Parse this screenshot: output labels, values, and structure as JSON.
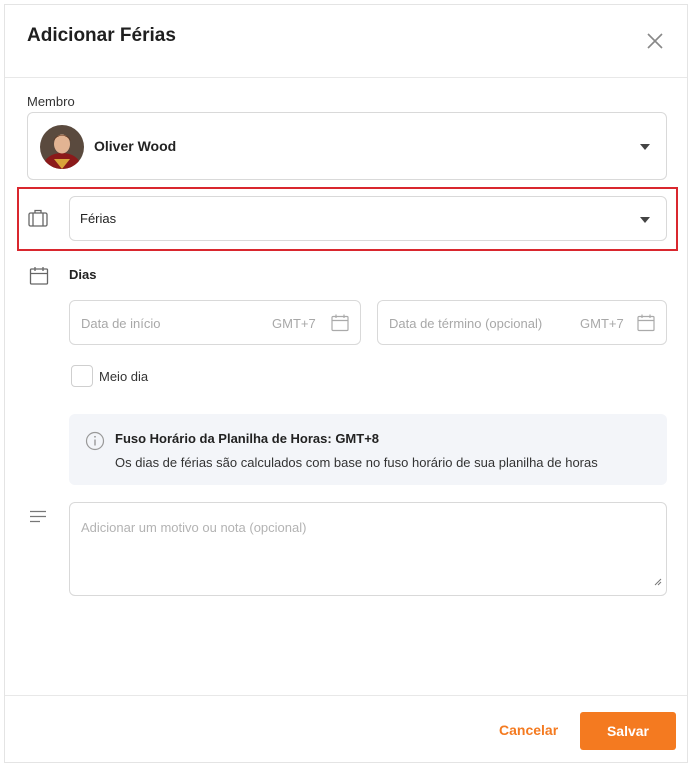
{
  "dialog": {
    "title": "Adicionar Férias"
  },
  "member": {
    "label": "Membro",
    "name": "Oliver Wood"
  },
  "leave_type": {
    "value": "Férias"
  },
  "days": {
    "label": "Dias",
    "start_placeholder": "Data de início",
    "start_timezone": "GMT+7",
    "end_placeholder": "Data de término (opcional)",
    "end_timezone": "GMT+7",
    "half_day_label": "Meio dia"
  },
  "info": {
    "title": "Fuso Horário da Planilha de Horas: GMT+8",
    "text": "Os dias de férias são calculados com base no fuso horário de sua planilha de horas"
  },
  "note": {
    "placeholder": "Adicionar um motivo ou nota (opcional)"
  },
  "footer": {
    "cancel_label": "Cancelar",
    "save_label": "Salvar"
  },
  "colors": {
    "accent": "#f47a20",
    "highlight": "#d9272e"
  }
}
